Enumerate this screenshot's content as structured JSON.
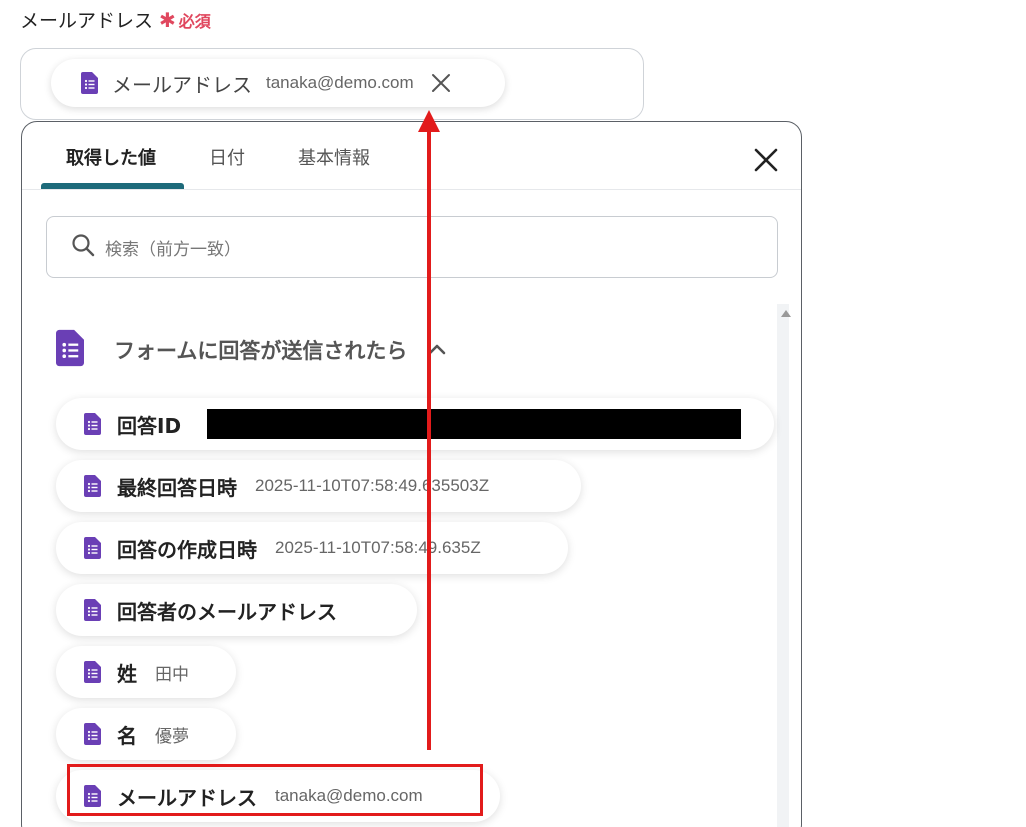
{
  "field": {
    "label": "メールアドレス",
    "required_mark": "✱",
    "required_text": "必須"
  },
  "selected_chip": {
    "icon": "google-forms-icon",
    "label": "メールアドレス",
    "value": "tanaka@demo.com",
    "remove_icon": "close-icon"
  },
  "panel": {
    "tabs": [
      {
        "label": "取得した値",
        "active": true
      },
      {
        "label": "日付",
        "active": false
      },
      {
        "label": "基本情報",
        "active": false
      }
    ],
    "close_icon": "close-icon",
    "search": {
      "icon": "search-icon",
      "placeholder": "検索（前方一致）"
    },
    "group": {
      "icon": "google-forms-icon",
      "title": "フォームに回答が送信されたら",
      "chevron": "chevron-up-icon"
    },
    "items": [
      {
        "label": "回答ID",
        "value": "",
        "redacted": true
      },
      {
        "label": "最終回答日時",
        "value": "2025-11-10T07:58:49.635503Z"
      },
      {
        "label": "回答の作成日時",
        "value": "2025-11-10T07:58:49.635Z"
      },
      {
        "label": "回答者のメールアドレス",
        "value": ""
      },
      {
        "label": "姓",
        "value": "田中"
      },
      {
        "label": "名",
        "value": "優夢"
      },
      {
        "label": "メールアドレス",
        "value": "tanaka@demo.com"
      }
    ]
  },
  "colors": {
    "accent_tab": "#1d6a7a",
    "icon_purple": "#6a3fb5",
    "annotation_red": "#e21b1b",
    "required_red": "#e0475e"
  }
}
